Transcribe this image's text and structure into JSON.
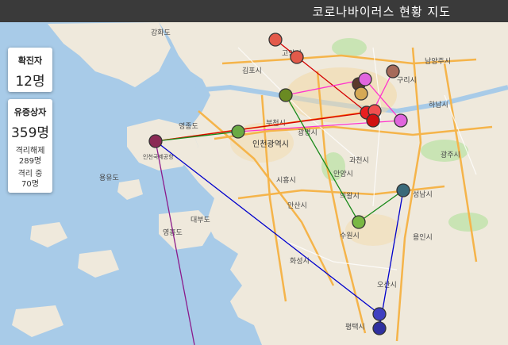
{
  "header": {
    "title": "코로나바이러스 현황 지도"
  },
  "confirmed_card": {
    "label": "확진자",
    "value": "12명"
  },
  "suspected_card": {
    "label": "유증상자",
    "value": "359명",
    "released_label": "격리해제",
    "released_value": "289명",
    "isolating_label": "격리 중",
    "isolating_value": "70명"
  },
  "map_labels": {
    "goyang": "고양시",
    "gimpo": "김포시",
    "bucheon": "부천시",
    "incheon": "인천광역시",
    "gwangmyeong": "광명시",
    "siheung": "시흥시",
    "ansan": "안산시",
    "anyang": "안양시",
    "gwacheon": "과천시",
    "uiwang": "의왕시",
    "suwon": "수원시",
    "hwaseong": "화성시",
    "osan": "오산시",
    "yongin": "용인시",
    "hanam": "하남시",
    "gwangju": "광주시",
    "namyangju": "남양주시",
    "guri": "구리시",
    "yeongjong": "영종도",
    "yongyu": "용유도",
    "ganghwa": "강화도",
    "yeonggwan": "영흥도",
    "daebu": "대부도",
    "seongnam": "성남시",
    "pyeongtaek": "평택시",
    "incheon_airport": "인천국제공항"
  },
  "colors": {
    "header_bg": "#3a3a3a",
    "land": "#efe9dc",
    "water": "#a8cbe8"
  }
}
